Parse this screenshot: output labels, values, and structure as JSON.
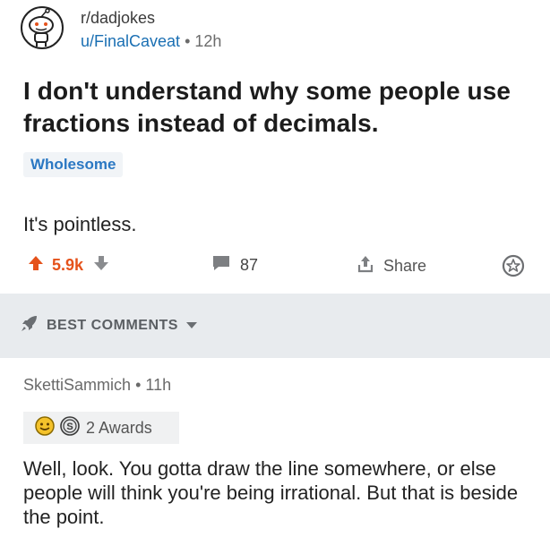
{
  "post": {
    "subreddit": "r/dadjokes",
    "author": "u/FinalCaveat",
    "separator": "•",
    "age": "12h",
    "title": "I don't understand why some people use fractions instead of decimals.",
    "flair": "Wholesome",
    "body": "It's pointless.",
    "score": "5.9k",
    "comment_count": "87",
    "share_label": "Share"
  },
  "sort": {
    "label": "BEST COMMENTS"
  },
  "comment": {
    "author": "SkettiSammich",
    "separator": "•",
    "age": "11h",
    "awards_label": "2 Awards",
    "body": "Well, look.  You gotta draw the line somewhere, or else people will think you're being irrational. But that is beside the point."
  },
  "colors": {
    "upvote_orange": "#e5521b",
    "link_blue": "#1a6fb3",
    "flair_blue": "#2b78c3",
    "sortbar_bg": "#e8ebee"
  }
}
